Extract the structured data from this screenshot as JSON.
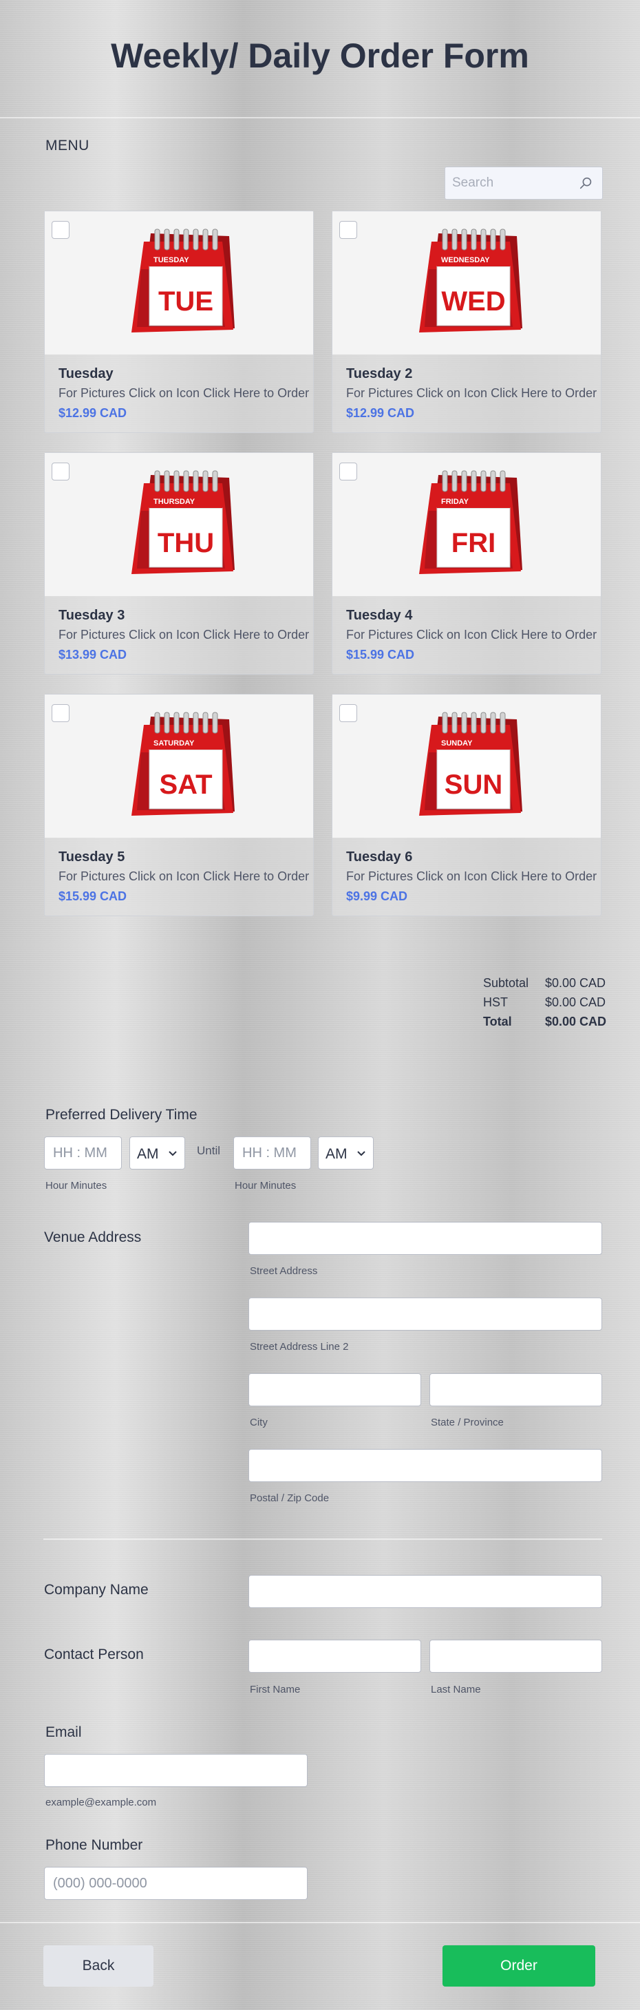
{
  "form": {
    "title": "Weekly/ Daily Order Form"
  },
  "menu": {
    "label": "MENU",
    "search_placeholder": "Search",
    "items": [
      {
        "name": "Tuesday",
        "description": "For Pictures Click on Icon Click Here to Order",
        "price": "$12.99 CAD",
        "day_full": "TUESDAY",
        "day_short": "TUE"
      },
      {
        "name": "Tuesday 2",
        "description": "For Pictures Click on Icon Click Here to Order",
        "price": "$12.99 CAD",
        "day_full": "WEDNESDAY",
        "day_short": "WED"
      },
      {
        "name": "Tuesday 3",
        "description": "For Pictures Click on Icon Click Here to Order",
        "price": "$13.99 CAD",
        "day_full": "THURSDAY",
        "day_short": "THU"
      },
      {
        "name": "Tuesday 4",
        "description": "For Pictures Click on Icon Click Here to Order",
        "price": "$15.99 CAD",
        "day_full": "FRIDAY",
        "day_short": "FRI"
      },
      {
        "name": "Tuesday 5",
        "description": "For Pictures Click on Icon Click Here to Order",
        "price": "$15.99 CAD",
        "day_full": "SATURDAY",
        "day_short": "SAT"
      },
      {
        "name": "Tuesday 6",
        "description": "For Pictures Click on Icon Click Here to Order",
        "price": "$9.99 CAD",
        "day_full": "SUNDAY",
        "day_short": "SUN"
      }
    ]
  },
  "summary": {
    "subtotal_label": "Subtotal",
    "subtotal_value": "$0.00 CAD",
    "hst_label": "HST",
    "hst_value": "$0.00 CAD",
    "total_label": "Total",
    "total_value": "$0.00 CAD"
  },
  "delivery": {
    "label": "Preferred Delivery Time",
    "time_placeholder": "HH : MM",
    "ampm_value": "AM",
    "until_label": "Until",
    "hour_minutes_label": "Hour Minutes"
  },
  "venue": {
    "label": "Venue Address",
    "street_label": "Street Address",
    "street2_label": "Street Address Line 2",
    "city_label": "City",
    "state_label": "State / Province",
    "postal_label": "Postal / Zip Code"
  },
  "company": {
    "label": "Company Name"
  },
  "contact": {
    "label": "Contact Person",
    "first_label": "First Name",
    "last_label": "Last Name"
  },
  "email": {
    "label": "Email",
    "hint": "example@example.com"
  },
  "phone": {
    "label": "Phone Number",
    "placeholder": "(000) 000-0000"
  },
  "buttons": {
    "back": "Back",
    "order": "Order"
  },
  "colors": {
    "accent": "#4c73e4",
    "order_button": "#18bd5b",
    "calendar_red": "#d7191c"
  }
}
